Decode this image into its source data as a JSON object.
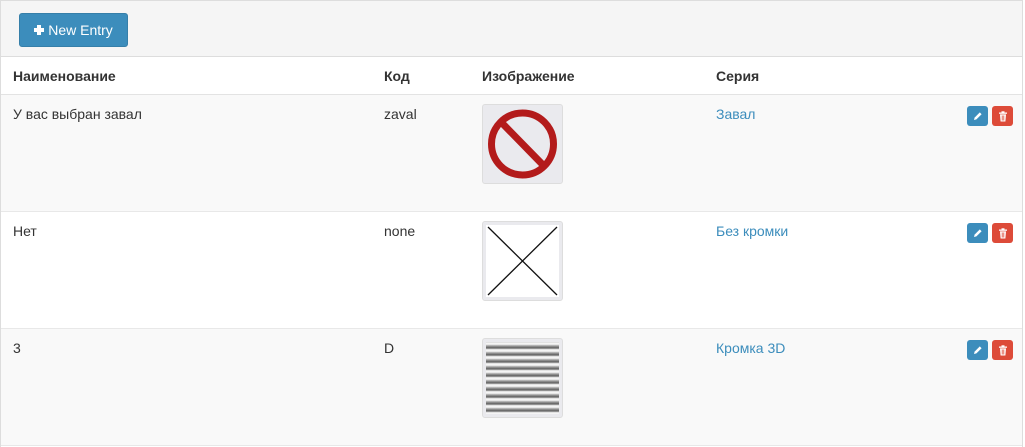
{
  "toolbar": {
    "new_entry_label": "New Entry"
  },
  "table": {
    "headers": {
      "name": "Наименование",
      "code": "Код",
      "image": "Изображение",
      "series": "Серия"
    },
    "rows": [
      {
        "name": "У вас выбран завал",
        "code": "zaval",
        "image_icon": "prohibited-sign-icon",
        "series": "Завал"
      },
      {
        "name": "Нет",
        "code": "none",
        "image_icon": "cross-x-icon",
        "series": "Без кромки"
      },
      {
        "name": "3",
        "code": "D",
        "image_icon": "striped-edge-texture-icon",
        "series": "Кромка 3D"
      }
    ]
  },
  "colors": {
    "primary": "#3c8dbc",
    "danger": "#dd4b39",
    "prohibited": "#b31b1b"
  }
}
